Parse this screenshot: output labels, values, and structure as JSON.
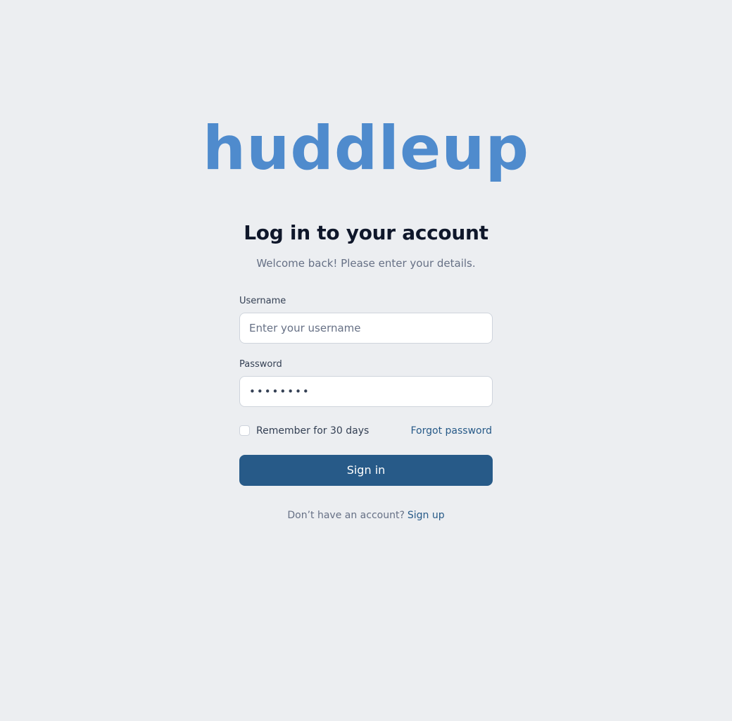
{
  "brand": {
    "logo_text": "huddleup",
    "logo_color": "#4f8bcd"
  },
  "header": {
    "title": "Log in to your account",
    "subtitle": "Welcome back! Please enter your details."
  },
  "form": {
    "username_label": "Username",
    "username_placeholder": "Enter your username",
    "username_value": "",
    "password_label": "Password",
    "password_value_masked": "••••••••",
    "remember_label": "Remember for 30 days",
    "remember_checked": false,
    "forgot_link": "Forgot password",
    "submit_label": "Sign in"
  },
  "footer": {
    "prompt": "Don’t have an account?",
    "signup_link": "Sign up"
  },
  "colors": {
    "background": "#eceef1",
    "primary": "#275a88",
    "logo": "#4f8bcd",
    "text_dark": "#0f172a",
    "text_muted": "#667085"
  }
}
